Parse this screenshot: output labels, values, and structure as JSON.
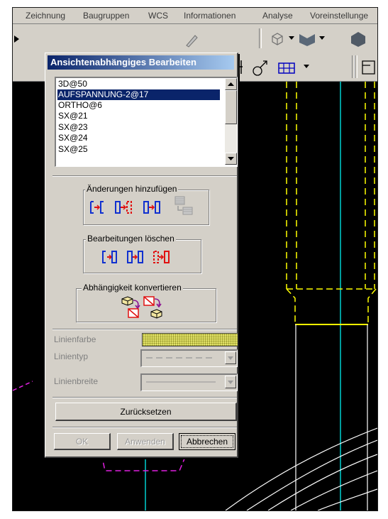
{
  "menubar": {
    "items": [
      "Zeichnung",
      "Baugruppen",
      "WCS",
      "Informationen",
      "Analyse",
      "Voreinstellunge"
    ]
  },
  "dialog": {
    "title": "Ansichtenabhängiges Bearbeiten",
    "views": [
      {
        "label": "3D@50",
        "selected": false
      },
      {
        "label": "AUFSPANNUNG-2@17",
        "selected": true
      },
      {
        "label": "ORTHO@6",
        "selected": false
      },
      {
        "label": "SX@21",
        "selected": false
      },
      {
        "label": "SX@23",
        "selected": false
      },
      {
        "label": "SX@24",
        "selected": false
      },
      {
        "label": "SX@25",
        "selected": false
      }
    ],
    "groups": {
      "add_modifications": "Änderungen hinzufügen",
      "delete_edits": "Bearbeitungen löschen",
      "convert_dependency": "Abhängigkeit konvertieren"
    },
    "properties": {
      "line_color_label": "Linienfarbe",
      "line_color": "#e3e36a",
      "line_type_label": "Linientyp",
      "line_width_label": "Linienbreite"
    },
    "reset_label": "Zurücksetzen",
    "ok_label": "OK",
    "apply_label": "Anwenden",
    "cancel_label": "Abbrechen"
  },
  "colors": {
    "cad_background": "#000000",
    "geometry_cyan": "#00d0d0",
    "geometry_yellow": "#ffff00",
    "geometry_magenta": "#e020e0",
    "titlebar_start": "#0a246a",
    "titlebar_end": "#a6caf0"
  }
}
